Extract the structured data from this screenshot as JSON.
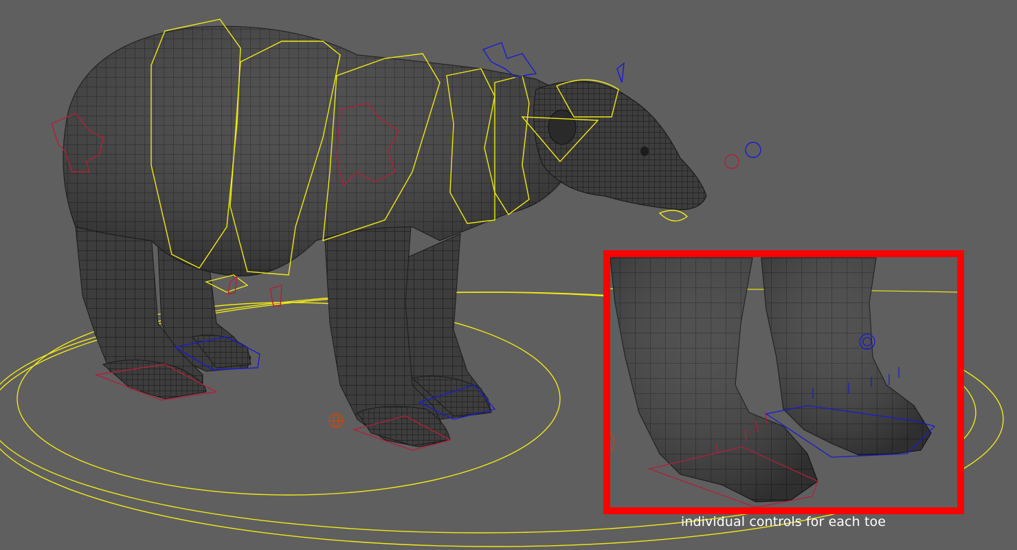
{
  "scene": {
    "background_color": "#5f5f5f",
    "mesh_color": "#3c3c3c",
    "wire_color": "#111111",
    "rig_colors": {
      "torso_controls": "#f2ea16",
      "left_side_controls": "#b0203c",
      "right_side_controls": "#1a1ad4",
      "root_control": "#c44a10"
    },
    "subject": "polar-bear-rig"
  },
  "inset": {
    "border_color": "#ff0000",
    "caption": "individual controls for each toe"
  }
}
